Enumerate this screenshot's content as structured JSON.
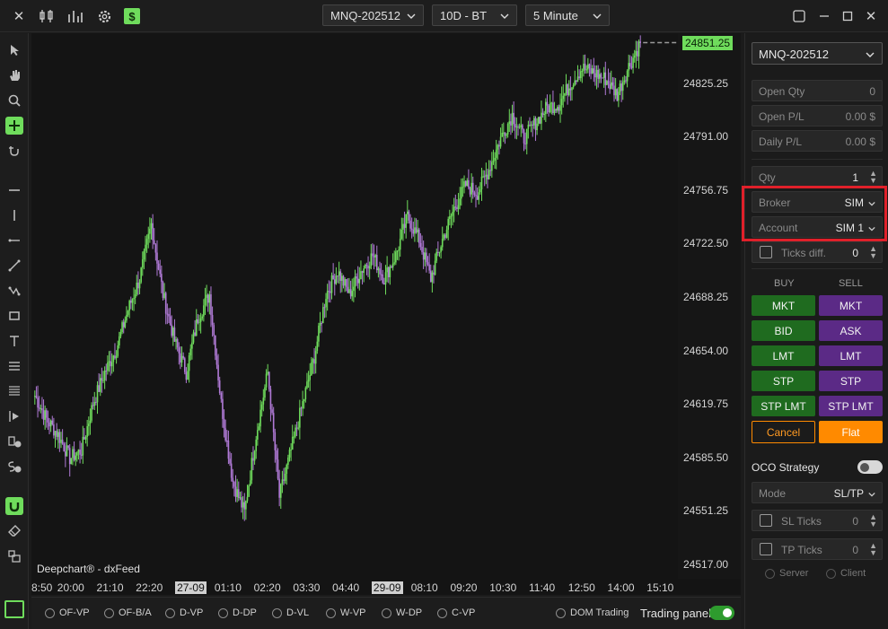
{
  "colors": {
    "bull": "#6fdc5c",
    "bear": "#b07ad6",
    "buy_button": "#1f6b1f",
    "sell_button": "#5b2a86",
    "flat": "#ff8a00",
    "highlight": "#e0202a"
  },
  "toolbar": {
    "icons": [
      "close-icon",
      "candlestick-icon",
      "bar-chart-icon",
      "gear-icon",
      "dollar-icon"
    ],
    "symbol": "MNQ-202512",
    "range": "10D - BT",
    "interval": "5 Minute",
    "window_controls": [
      "float-window-icon",
      "minimize-icon",
      "maximize-icon",
      "close-window-icon"
    ]
  },
  "left_tools": [
    "cursor-icon",
    "hand-icon",
    "zoom-icon",
    "crosshair-icon",
    "snap-icon",
    "horizontal-line-icon",
    "vertical-line-icon",
    "ray-icon",
    "trend-line-icon",
    "polyline-icon",
    "rectangle-icon",
    "text-icon",
    "fib-icon",
    "levels-icon",
    "order-icon",
    "buy-order-icon",
    "sell-order-icon",
    "magnet-icon",
    "eraser-icon",
    "layers-icon"
  ],
  "chart_data": {
    "type": "candlestick",
    "series": [
      {
        "values": [
          24625,
          24610,
          24600,
          24585,
          24590,
          24620,
          24640,
          24655,
          24680,
          24700,
          24735,
          24690,
          24660,
          24640,
          24675,
          24690,
          24620,
          24570,
          24550,
          24600,
          24640,
          24560,
          24590,
          24620,
          24650,
          24690,
          24705,
          24690,
          24705,
          24715,
          24700,
          24715,
          24740,
          24725,
          24700,
          24725,
          24745,
          24760,
          24755,
          24770,
          24790,
          24805,
          24790,
          24800,
          24810,
          24812,
          24825,
          24835,
          24832,
          24828,
          24818,
          24836,
          24851
        ]
      }
    ],
    "ylim": [
      24510,
      24855
    ],
    "price_ticks": [
      "24825.25",
      "24791.00",
      "24756.75",
      "24722.50",
      "24688.25",
      "24654.00",
      "24619.75",
      "24585.50",
      "24551.25",
      "24517.00"
    ],
    "current_price": "24851.25",
    "time_ticks": [
      "8:50",
      "20:00",
      "21:10",
      "22:20",
      "27-09",
      "01:10",
      "02:20",
      "03:30",
      "04:40",
      "29-09",
      "08:10",
      "09:20",
      "10:30",
      "11:40",
      "12:50",
      "14:00",
      "15:10"
    ],
    "watermark": "Deepchart® - dxFeed"
  },
  "bottom": {
    "options": [
      "OF-VP",
      "OF-B/A",
      "D-VP",
      "D-DP",
      "D-VL",
      "W-VP",
      "W-DP",
      "C-VP"
    ],
    "dom_trading": "DOM Trading",
    "trading_panel": "Trading panel",
    "trading_panel_on": true
  },
  "panel": {
    "symbol": "MNQ-202512",
    "open_qty": {
      "label": "Open Qty",
      "value": "0"
    },
    "open_pl": {
      "label": "Open P/L",
      "value": "0.00 $"
    },
    "daily_pl": {
      "label": "Daily P/L",
      "value": "0.00 $"
    },
    "qty": {
      "label": "Qty",
      "value": "1"
    },
    "broker": {
      "label": "Broker",
      "value": "SIM"
    },
    "account": {
      "label": "Account",
      "value": "SIM 1"
    },
    "ticks_diff": {
      "label": "Ticks diff.",
      "value": "0"
    },
    "buy_header": "BUY",
    "sell_header": "SELL",
    "buy_buttons": [
      "MKT",
      "BID",
      "LMT",
      "STP",
      "STP LMT"
    ],
    "sell_buttons": [
      "MKT",
      "ASK",
      "LMT",
      "STP",
      "STP LMT"
    ],
    "cancel": "Cancel",
    "flat": "Flat",
    "oco_label": "OCO Strategy",
    "mode": {
      "label": "Mode",
      "value": "SL/TP"
    },
    "sl_ticks": {
      "label": "SL Ticks",
      "value": "0"
    },
    "tp_ticks": {
      "label": "TP Ticks",
      "value": "0"
    },
    "server": "Server",
    "client": "Client"
  }
}
